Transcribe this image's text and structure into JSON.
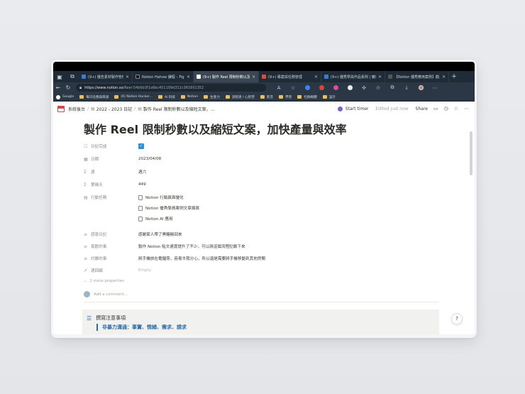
{
  "browser": {
    "tabs": [
      {
        "label": "(9+) 優告素材製作管理",
        "fav_color": "#3a7bd5",
        "active": false
      },
      {
        "label": "Notion Hahow 課程 – Figma",
        "fav_color": "#111111",
        "active": false
      },
      {
        "label": "(9+) 製作 Reel 限制秒數以及...",
        "fav_color": "#ffffff",
        "active": true
      },
      {
        "label": "(9+) 專案與任務管理",
        "fav_color": "#e04a3a",
        "active": false
      },
      {
        "label": "(9+) 優秀學員作品系例 | 實用",
        "fav_color": "#3a7bd5",
        "active": false
      },
      {
        "label": "【Notion 優秀應用案例】觀...",
        "fav_color": "#555555",
        "active": false
      }
    ],
    "url_host": "https://www.notion.so",
    "url_path": "/Reel-54b6b3f1a6bc451199d311c361601352",
    "bookmarks": [
      {
        "label": "Google",
        "type": "google"
      },
      {
        "label": "每日任務與目錄",
        "type": "folder"
      },
      {
        "label": "(6) Notion Hacker...",
        "type": "folder"
      },
      {
        "label": "AI 科技",
        "type": "folder"
      },
      {
        "label": "Notion",
        "type": "folder"
      },
      {
        "label": "生產力",
        "type": "folder"
      },
      {
        "label": "說程達 / 心智塑",
        "type": "folder"
      },
      {
        "label": "影音",
        "type": "folder"
      },
      {
        "label": "學習",
        "type": "folder"
      },
      {
        "label": "社群媒體",
        "type": "folder"
      },
      {
        "label": "設計",
        "type": "folder"
      }
    ]
  },
  "notion_topbar": {
    "breadcrumbs": [
      "系統後台",
      "2022 - 2023 日記",
      "製作 Reel 限制秒數以及縮短文案，..."
    ],
    "start_timer": "Start timer",
    "edited": "Edited just now",
    "share": "Share"
  },
  "page": {
    "title": "製作 Reel 限制秒數以及縮短文案，加快產量與效率",
    "properties": [
      {
        "icon": "☐",
        "name": "日記完成",
        "type": "checkbox",
        "value": "✓"
      },
      {
        "icon": "▦",
        "name": "日期",
        "type": "text",
        "value": "2023/04/08"
      },
      {
        "icon": "Σ",
        "name": "週",
        "type": "text",
        "value": "週六"
      },
      {
        "icon": "Σ",
        "name": "第幾天",
        "type": "text",
        "value": "449"
      },
      {
        "icon": "▤",
        "name": "行動任務",
        "type": "relation",
        "values": [
          "Notion 行銷頁面優化",
          "Notion 優秀學員案例文章撰寫",
          "Notion AI 應用"
        ]
      },
      {
        "icon": "≡",
        "name": "感恩日記",
        "type": "text",
        "value": "感謝家人帶了黑糖糕回來"
      },
      {
        "icon": "≡",
        "name": "喜歡的事",
        "type": "text",
        "value": "製作 Notion 貼文速度提升了不少，可以將這個流程記錄下來"
      },
      {
        "icon": "≡",
        "name": "討厭的事",
        "type": "text",
        "value": "將手機放在電腦旁，容易令我分心，所以還是需要將手機移動到其他房間"
      },
      {
        "icon": "↗",
        "name": "週回顧",
        "type": "empty",
        "value": "Empty"
      }
    ],
    "more_properties": "2 more properties",
    "add_comment": "Add a comment...",
    "callout_title": "撰寫注意事項",
    "callout_quote": "非暴力溝通：事實、情緒、需求、請求",
    "help": "?"
  }
}
